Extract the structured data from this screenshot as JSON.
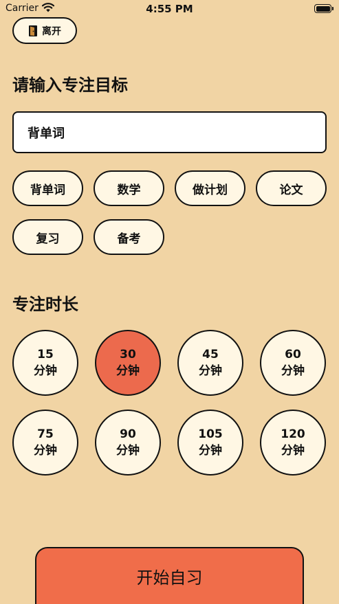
{
  "status_bar": {
    "carrier": "Carrier",
    "time": "4:55 PM"
  },
  "leave_button": {
    "label": "离开",
    "icon": "door-icon"
  },
  "goal": {
    "title": "请输入专注目标",
    "input_value": "背单词",
    "presets": [
      "背单词",
      "数学",
      "做计划",
      "论文",
      "复习",
      "备考"
    ]
  },
  "duration": {
    "title": "专注时长",
    "unit": "分钟",
    "options": [
      "15",
      "30",
      "45",
      "60",
      "75",
      "90",
      "105",
      "120"
    ],
    "selected": "30"
  },
  "start_button": {
    "label": "开始自习"
  },
  "colors": {
    "background": "#F1D4A4",
    "chip": "#FFF7E4",
    "selected": "#EC6A4D",
    "start_button": "#F06D4A"
  }
}
